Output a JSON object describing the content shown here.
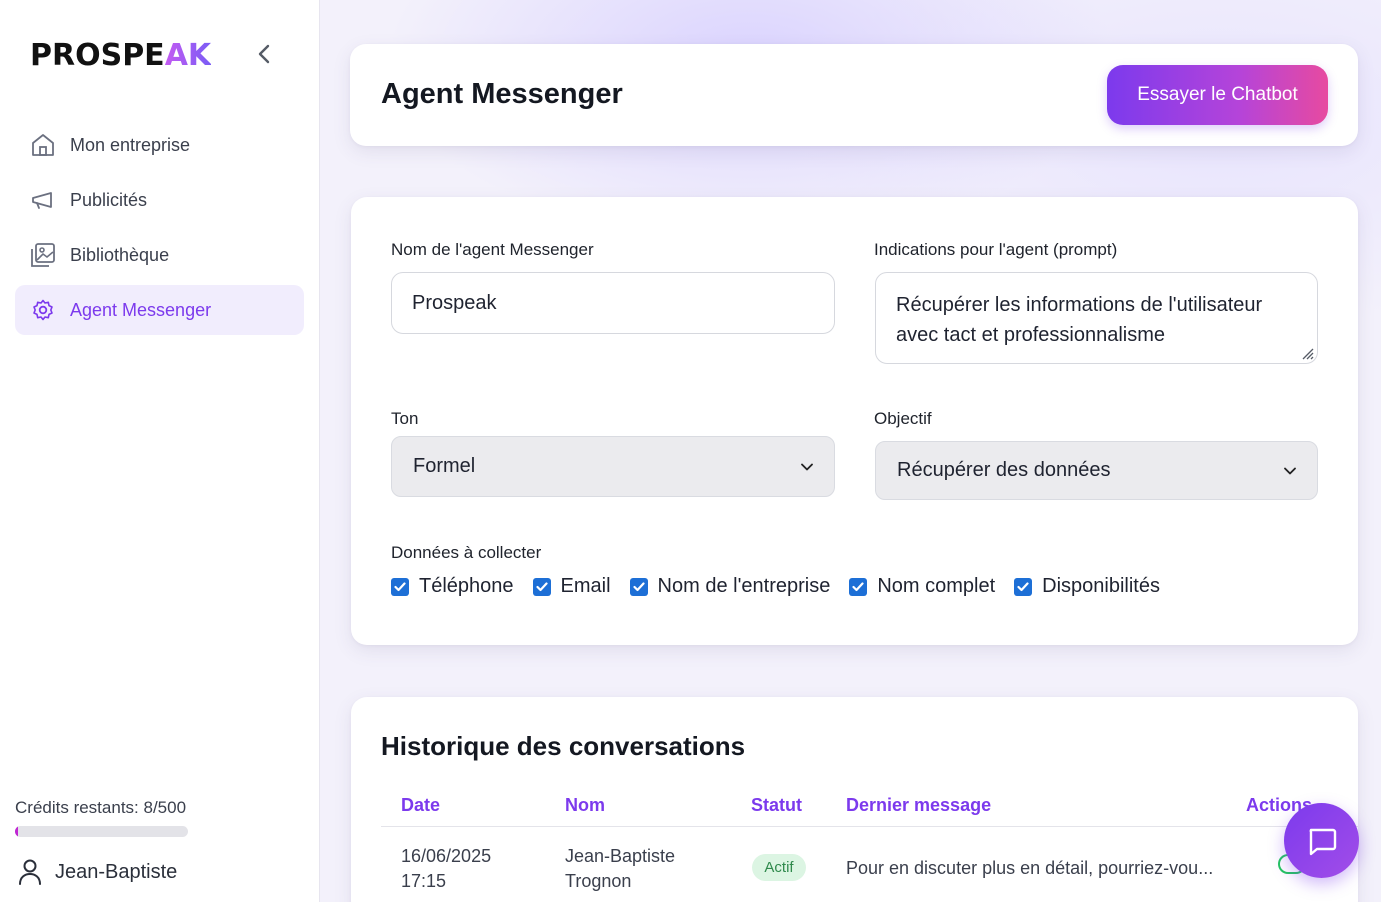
{
  "brand": {
    "logo_main": "PROSPE",
    "logo_accent": "AK"
  },
  "sidebar": {
    "items": [
      {
        "label": "Mon entreprise",
        "icon": "home-icon",
        "active": false
      },
      {
        "label": "Publicités",
        "icon": "megaphone-icon",
        "active": false
      },
      {
        "label": "Bibliothèque",
        "icon": "images-icon",
        "active": false
      },
      {
        "label": "Agent Messenger",
        "icon": "gear-icon",
        "active": true
      }
    ],
    "credits_label": "Crédits restants: 8/500",
    "credits_fraction": 0.016,
    "user_name": "Jean-Baptiste"
  },
  "header": {
    "title": "Agent Messenger",
    "chatbot_button": "Essayer le Chatbot"
  },
  "form": {
    "agent_name_label": "Nom de l'agent Messenger",
    "agent_name_value": "Prospeak",
    "prompt_label": "Indications pour l'agent (prompt)",
    "prompt_value": "Récupérer les informations de l'utilisateur avec tact et professionnalisme",
    "tone_label": "Ton",
    "tone_value": "Formel",
    "objective_label": "Objectif",
    "objective_value": "Récupérer des données",
    "collect_label": "Données à collecter",
    "checkboxes": [
      {
        "label": "Téléphone",
        "checked": true
      },
      {
        "label": "Email",
        "checked": true
      },
      {
        "label": "Nom de l'entreprise",
        "checked": true
      },
      {
        "label": "Nom complet",
        "checked": true
      },
      {
        "label": "Disponibilités",
        "checked": true
      }
    ]
  },
  "history": {
    "title": "Historique des conversations",
    "columns": [
      "Date",
      "Nom",
      "Statut",
      "Dernier message",
      "Actions"
    ],
    "rows": [
      {
        "date_line1": "16/06/2025",
        "date_line2": "17:15",
        "name_line1": "Jean-Baptiste",
        "name_line2": "Trognon",
        "status": "Actif",
        "last_message": "Pour en discuter plus en détail, pourriez-vou..."
      }
    ]
  },
  "colors": {
    "accent": "#7c3aed",
    "checkbox": "#1d6fd6",
    "status_bg": "#dcf5e3",
    "status_text": "#2f8a4c"
  }
}
